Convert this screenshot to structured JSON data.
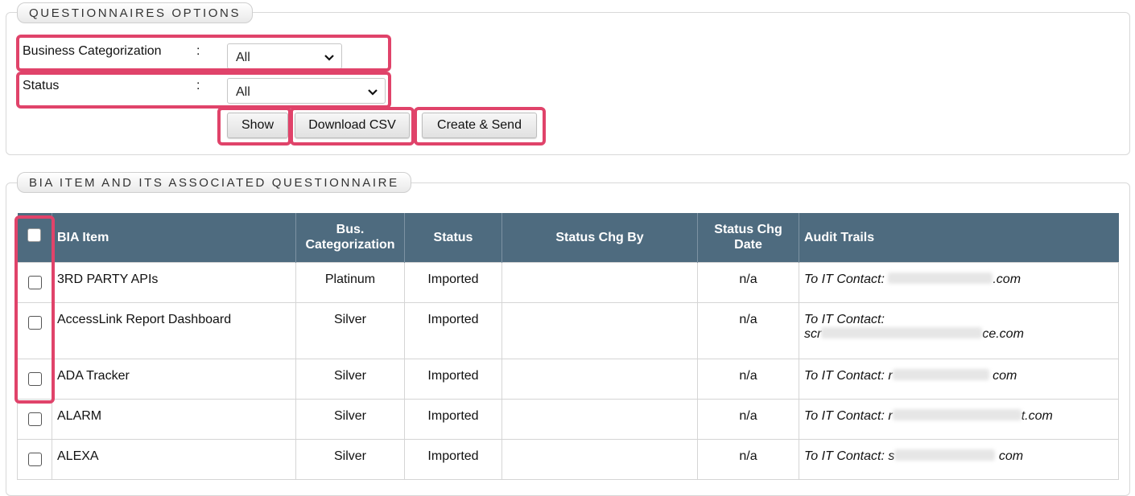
{
  "options_panel": {
    "legend": "QUESTIONNAIRES OPTIONS",
    "business_categorization": {
      "label": "Business Categorization",
      "colon": ":",
      "value": "All"
    },
    "status": {
      "label": "Status",
      "colon": ":",
      "value": "All"
    },
    "buttons": {
      "show": "Show",
      "download_csv": "Download CSV",
      "create_send": "Create & Send"
    }
  },
  "items_panel": {
    "legend": "BIA ITEM AND ITS ASSOCIATED QUESTIONNAIRE",
    "columns": {
      "bia_item": "BIA Item",
      "bus_cat_line1": "Bus.",
      "bus_cat_line2": "Categorization",
      "status": "Status",
      "status_chg_by": "Status Chg By",
      "status_chg_date_line1": "Status Chg",
      "status_chg_date_line2": "Date",
      "audit_trails": "Audit Trails"
    },
    "rows": [
      {
        "bia_item": "3RD PARTY APIs",
        "bus_cat": "Platinum",
        "status": "Imported",
        "status_chg_by": "",
        "status_chg_date": "n/a",
        "audit_prefix": "To IT Contact:",
        "audit_visible": "",
        "audit_suffix": ".com"
      },
      {
        "bia_item": "AccessLink Report Dashboard",
        "bus_cat": "Silver",
        "status": "Imported",
        "status_chg_by": "",
        "status_chg_date": "n/a",
        "audit_prefix": "To IT Contact:",
        "audit_visible": "scr",
        "audit_suffix": "ce.com"
      },
      {
        "bia_item": "ADA Tracker",
        "bus_cat": "Silver",
        "status": "Imported",
        "status_chg_by": "",
        "status_chg_date": "n/a",
        "audit_prefix": "To IT Contact:",
        "audit_visible": "r",
        "audit_suffix": "com"
      },
      {
        "bia_item": "ALARM",
        "bus_cat": "Silver",
        "status": "Imported",
        "status_chg_by": "",
        "status_chg_date": "n/a",
        "audit_prefix": "To IT Contact:",
        "audit_visible": "r",
        "audit_suffix": "t.com"
      },
      {
        "bia_item": "ALEXA",
        "bus_cat": "Silver",
        "status": "Imported",
        "status_chg_by": "",
        "status_chg_date": "n/a",
        "audit_prefix": "To IT Contact:",
        "audit_visible": "s",
        "audit_suffix": "com"
      }
    ]
  },
  "colors": {
    "header_bg": "#4e6b7f",
    "highlight": "#e0436a"
  }
}
